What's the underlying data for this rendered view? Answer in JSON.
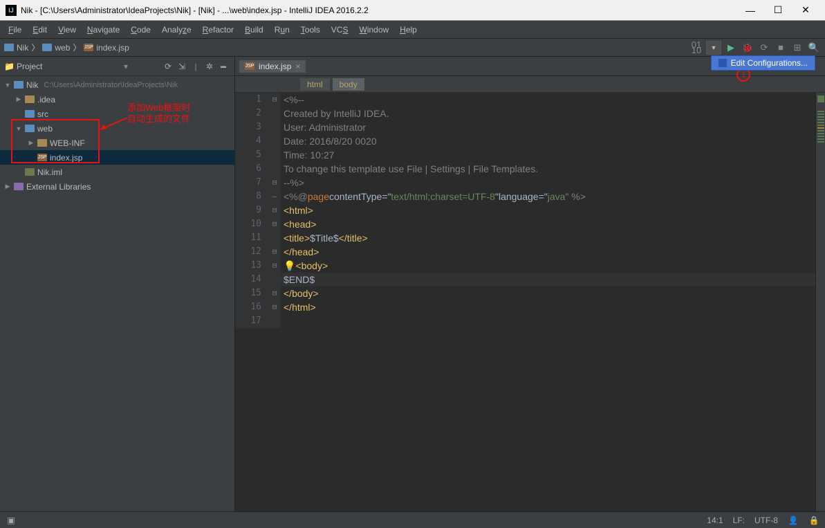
{
  "window": {
    "title": "Nik - [C:\\Users\\Administrator\\IdeaProjects\\Nik] - [Nik] - ...\\web\\index.jsp - IntelliJ IDEA 2016.2.2"
  },
  "menubar": [
    "File",
    "Edit",
    "View",
    "Navigate",
    "Code",
    "Analyze",
    "Refactor",
    "Build",
    "Run",
    "Tools",
    "VCS",
    "Window",
    "Help"
  ],
  "breadcrumb": {
    "seg1": "Nik",
    "seg2": "web",
    "seg3": "index.jsp"
  },
  "edit_config": "Edit Configurations...",
  "annotation": {
    "circle": "1",
    "note_line1": "添加Web框架时",
    "note_line2": "自动生成的文件"
  },
  "project_panel": {
    "title": "Project"
  },
  "tree": {
    "root": {
      "label": "Nik",
      "path": "C:\\Users\\Administrator\\IdeaProjects\\Nik"
    },
    "idea": ".idea",
    "src": "src",
    "web": "web",
    "webinf": "WEB-INF",
    "indexjsp": "index.jsp",
    "iml": "Nik.iml",
    "ext": "External Libraries"
  },
  "tab": {
    "name": "index.jsp"
  },
  "crumbs": {
    "html": "html",
    "body": "body"
  },
  "code_lines": [
    "<%--",
    "  Created by IntelliJ IDEA.",
    "  User: Administrator",
    "  Date: 2016/8/20 0020",
    "  Time: 10:27",
    "  To change this template use File | Settings | File Templates.",
    "--%>",
    "",
    "<html>",
    "  <head>",
    "    <title>$Title$</title>",
    "  </head>",
    "  <body>",
    "    $END$",
    "  </body>",
    "</html>",
    ""
  ],
  "directive": {
    "prefix": "<%@ ",
    "page": "page",
    "ct_attr": " contentType=\"",
    "ct_val": "text/html;charset=UTF-8",
    "q1": "\" ",
    "lang_attr": "language=\"",
    "lang_val": "java",
    "suffix": "\" %>"
  },
  "statusbar": {
    "pos": "14:1",
    "le": "LF:",
    "enc": "UTF-8"
  }
}
